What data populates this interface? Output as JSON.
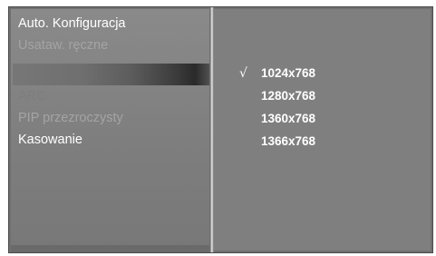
{
  "menu": {
    "items": [
      {
        "label": "Auto. Konfiguracja",
        "state": "active"
      },
      {
        "label": "Usataw. ręczne",
        "state": "dim"
      },
      {
        "label": "",
        "state": "selected"
      },
      {
        "label": "ARC",
        "state": "ghost"
      },
      {
        "label": "PIP przezroczysty",
        "state": "dim"
      },
      {
        "label": "Kasowanie",
        "state": "active"
      }
    ]
  },
  "resolutions": {
    "check_symbol": "√",
    "selected": "1024x768",
    "options": [
      "1024x768",
      "1280x768",
      "1360x768",
      "1366x768"
    ]
  },
  "colors": {
    "panel": "#7f7f7f",
    "text_active": "#ffffff",
    "text_dim": "#a4a4a4"
  }
}
